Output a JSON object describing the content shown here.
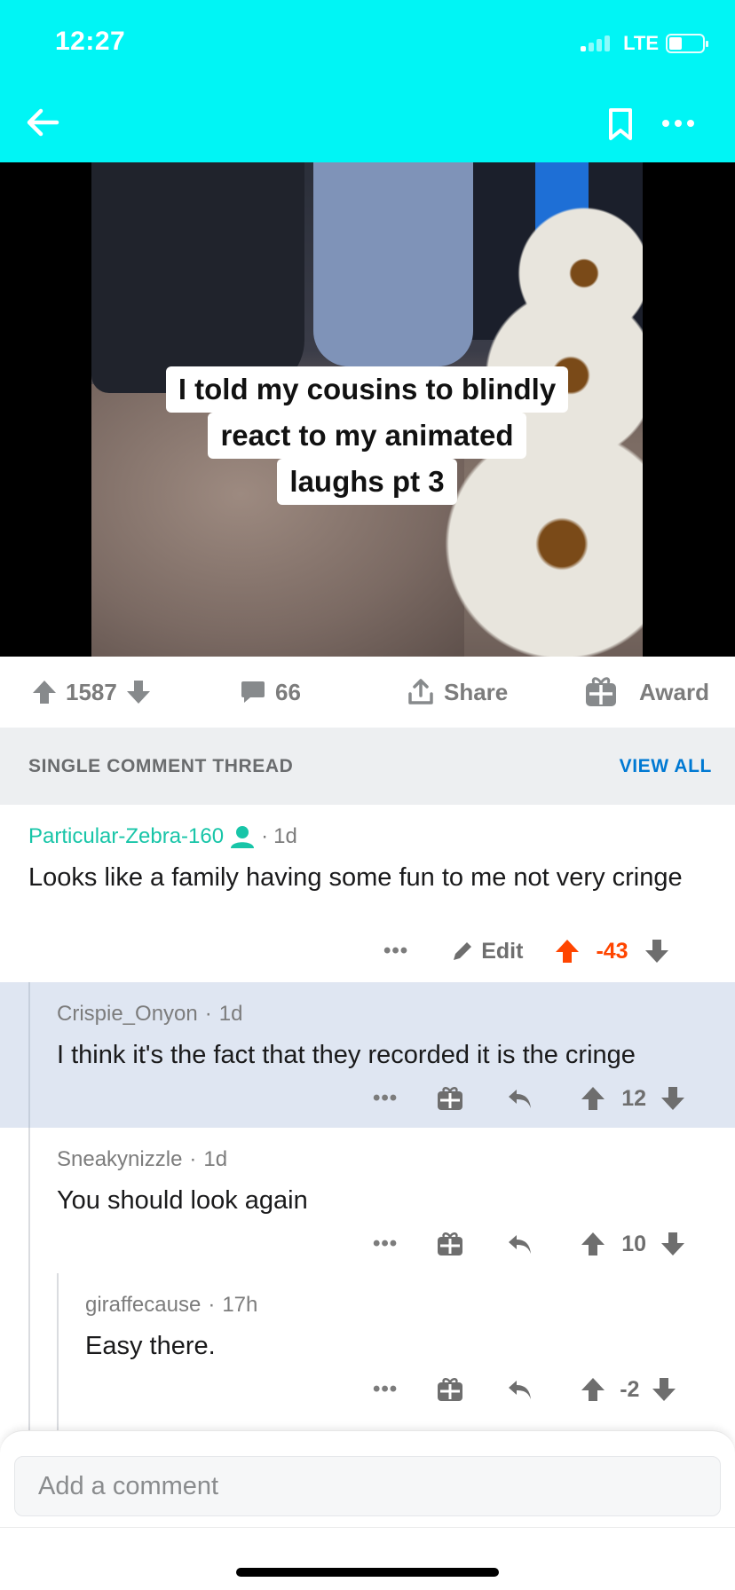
{
  "status_bar": {
    "time": "12:27",
    "network": "LTE"
  },
  "media": {
    "caption_lines": [
      "I told my cousins to blindly",
      "react to my animated",
      "laughs pt 3"
    ]
  },
  "actions": {
    "upvotes": "1587",
    "comments": "66",
    "share": "Share",
    "award": "Award"
  },
  "thread": {
    "title": "SINGLE COMMENT THREAD",
    "view_all": "VIEW ALL"
  },
  "comments": [
    {
      "author": "Particular-Zebra-160",
      "age": "1d",
      "body": "Looks like a family having some fun to me not very cringe",
      "edit": "Edit",
      "score": "-43",
      "upvoted": true
    },
    {
      "author": "Crispie_Onyon",
      "age": "1d",
      "body": "I think it's the fact that they recorded it is the cringe",
      "score": "12"
    },
    {
      "author": "Sneakynizzle",
      "age": "1d",
      "body": "You should look again",
      "score": "10"
    },
    {
      "author": "giraffecause",
      "age": "17h",
      "body": "Easy there.",
      "score": "-2"
    }
  ],
  "comment_input": {
    "placeholder": "Add a comment"
  },
  "colors": {
    "header": "#00f5f5",
    "upvote_active": "#ff4500",
    "link": "#0079d3",
    "mint_author": "#18c5a8",
    "highlight_bg": "#dfe6f2"
  }
}
